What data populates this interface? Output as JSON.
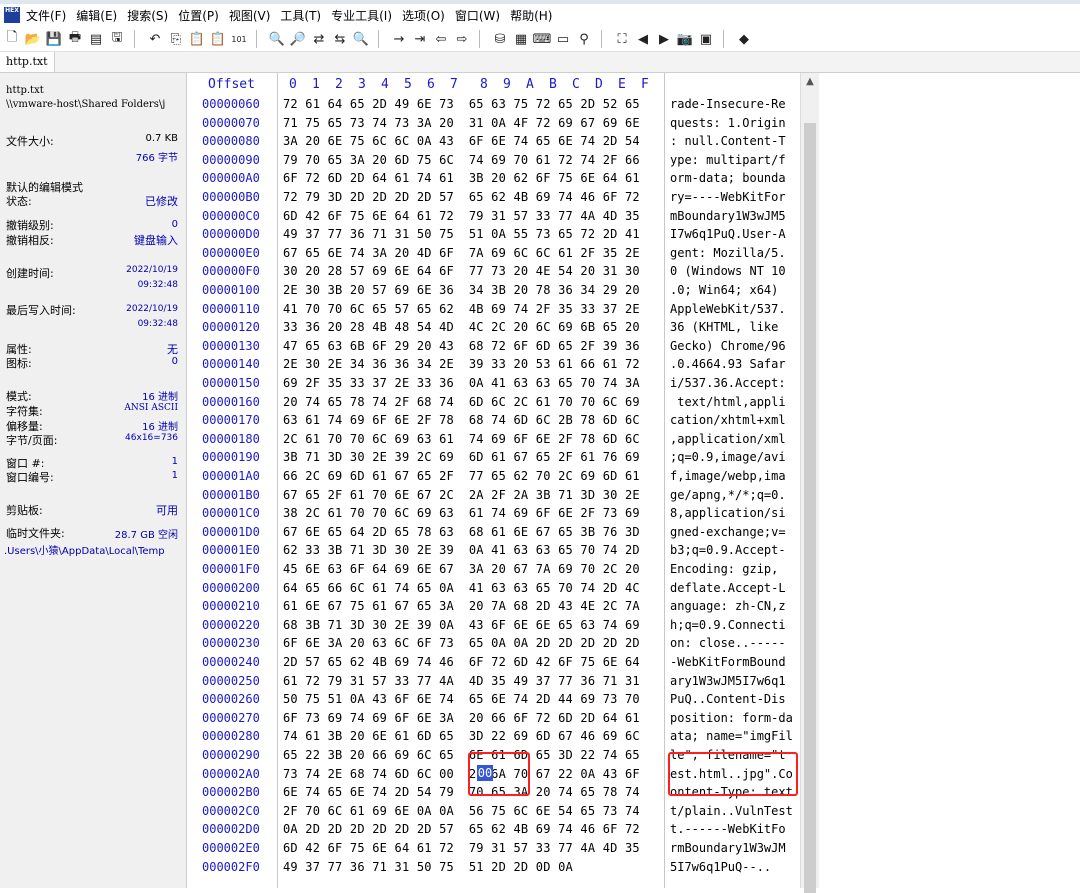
{
  "app": {
    "logo_text": "HEX"
  },
  "menu": [
    "文件(F)",
    "编辑(E)",
    "搜索(S)",
    "位置(P)",
    "视图(V)",
    "工具(T)",
    "专业工具(I)",
    "选项(O)",
    "窗口(W)",
    "帮助(H)"
  ],
  "toolbar_icons": [
    "new-file",
    "open-folder",
    "save",
    "print",
    "properties",
    "open-disk",
    "sep",
    "undo",
    "copy",
    "paste",
    "paste-special",
    "copy-hex",
    "sep",
    "find",
    "find-hex",
    "replace",
    "replace-hex",
    "find-next",
    "sep",
    "goto-offset",
    "goto-sector",
    "back",
    "forward",
    "sep",
    "disk-editor",
    "ram-editor",
    "calculator",
    "data-interpreter",
    "magnifier",
    "sep",
    "analysis",
    "previous",
    "next",
    "camera",
    "table",
    "sep",
    "bookmark"
  ],
  "tab": {
    "name": "http.txt"
  },
  "sidebar": {
    "file_name": "http.txt",
    "path": "\\\\vmware-host\\Shared Folders\\j",
    "size_label": "文件大小:",
    "size_kb": "0.7 KB",
    "size_bytes": "766 字节",
    "edit_mode_label": "默认的编辑模式",
    "state_label": "状态:",
    "state_value": "已修改",
    "undo_level_label": "撤销级别:",
    "undo_level_value": "0",
    "undo_reverse_label": "撤销相反:",
    "undo_reverse_value": "键盘输入",
    "created_label": "创建时间:",
    "created_date": "2022/10/19",
    "created_time": "09:32:48",
    "modified_label": "最后写入时间:",
    "modified_date": "2022/10/19",
    "modified_time": "09:32:48",
    "attr_label": "属性:",
    "attr_value": "无",
    "icon_label": "图标:",
    "icon_value": "0",
    "mode_label": "模式:",
    "mode_value": "16 进制",
    "charset_label": "字符集:",
    "charset_value": "ANSI ASCII",
    "offset_label": "偏移量:",
    "offset_value": "16 进制",
    "bpp_label": "字节/页面:",
    "bpp_value": "46x16=736",
    "window_label": "窗口 #:",
    "window_value": "1",
    "window_no_label": "窗口编号:",
    "window_no_value": "1",
    "clipboard_label": "剪贴板:",
    "clipboard_value": "可用",
    "tempfolder_label": "临时文件夹:",
    "tempfolder_value": "28.7 GB 空闲",
    "temp_path": ".Users\\小猿\\AppData\\Local\\Temp"
  },
  "editor": {
    "offset_header": "Offset",
    "col_headers": [
      "0",
      "1",
      "2",
      "3",
      "4",
      "5",
      "6",
      "7",
      "8",
      "9",
      "A",
      "B",
      "C",
      "D",
      "E",
      "F"
    ],
    "rows": [
      {
        "offset": "00000060",
        "hex": "72 61 64 65 2D 49 6E 73  65 63 75 72 65 2D 52 65",
        "ascii": "rade-Insecure-Re"
      },
      {
        "offset": "00000070",
        "hex": "71 75 65 73 74 73 3A 20  31 0A 4F 72 69 67 69 6E",
        "ascii": "quests: 1.Origin"
      },
      {
        "offset": "00000080",
        "hex": "3A 20 6E 75 6C 6C 0A 43  6F 6E 74 65 6E 74 2D 54",
        "ascii": ": null.Content-T"
      },
      {
        "offset": "00000090",
        "hex": "79 70 65 3A 20 6D 75 6C  74 69 70 61 72 74 2F 66",
        "ascii": "ype: multipart/f"
      },
      {
        "offset": "000000A0",
        "hex": "6F 72 6D 2D 64 61 74 61  3B 20 62 6F 75 6E 64 61",
        "ascii": "orm-data; bounda"
      },
      {
        "offset": "000000B0",
        "hex": "72 79 3D 2D 2D 2D 2D 57  65 62 4B 69 74 46 6F 72",
        "ascii": "ry=----WebKitFor"
      },
      {
        "offset": "000000C0",
        "hex": "6D 42 6F 75 6E 64 61 72  79 31 57 33 77 4A 4D 35",
        "ascii": "mBoundary1W3wJM5"
      },
      {
        "offset": "000000D0",
        "hex": "49 37 77 36 71 31 50 75  51 0A 55 73 65 72 2D 41",
        "ascii": "I7w6q1PuQ.User-A"
      },
      {
        "offset": "000000E0",
        "hex": "67 65 6E 74 3A 20 4D 6F  7A 69 6C 6C 61 2F 35 2E",
        "ascii": "gent: Mozilla/5."
      },
      {
        "offset": "000000F0",
        "hex": "30 20 28 57 69 6E 64 6F  77 73 20 4E 54 20 31 30",
        "ascii": "0 (Windows NT 10"
      },
      {
        "offset": "00000100",
        "hex": "2E 30 3B 20 57 69 6E 36  34 3B 20 78 36 34 29 20",
        "ascii": ".0; Win64; x64) "
      },
      {
        "offset": "00000110",
        "hex": "41 70 70 6C 65 57 65 62  4B 69 74 2F 35 33 37 2E",
        "ascii": "AppleWebKit/537."
      },
      {
        "offset": "00000120",
        "hex": "33 36 20 28 4B 48 54 4D  4C 2C 20 6C 69 6B 65 20",
        "ascii": "36 (KHTML, like "
      },
      {
        "offset": "00000130",
        "hex": "47 65 63 6B 6F 29 20 43  68 72 6F 6D 65 2F 39 36",
        "ascii": "Gecko) Chrome/96"
      },
      {
        "offset": "00000140",
        "hex": "2E 30 2E 34 36 36 34 2E  39 33 20 53 61 66 61 72",
        "ascii": ".0.4664.93 Safar"
      },
      {
        "offset": "00000150",
        "hex": "69 2F 35 33 37 2E 33 36  0A 41 63 63 65 70 74 3A",
        "ascii": "i/537.36.Accept:"
      },
      {
        "offset": "00000160",
        "hex": "20 74 65 78 74 2F 68 74  6D 6C 2C 61 70 70 6C 69",
        "ascii": " text/html,appli"
      },
      {
        "offset": "00000170",
        "hex": "63 61 74 69 6F 6E 2F 78  68 74 6D 6C 2B 78 6D 6C",
        "ascii": "cation/xhtml+xml"
      },
      {
        "offset": "00000180",
        "hex": "2C 61 70 70 6C 69 63 61  74 69 6F 6E 2F 78 6D 6C",
        "ascii": ",application/xml"
      },
      {
        "offset": "00000190",
        "hex": "3B 71 3D 30 2E 39 2C 69  6D 61 67 65 2F 61 76 69",
        "ascii": ";q=0.9,image/avi"
      },
      {
        "offset": "000001A0",
        "hex": "66 2C 69 6D 61 67 65 2F  77 65 62 70 2C 69 6D 61",
        "ascii": "f,image/webp,ima"
      },
      {
        "offset": "000001B0",
        "hex": "67 65 2F 61 70 6E 67 2C  2A 2F 2A 3B 71 3D 30 2E",
        "ascii": "ge/apng,*/*;q=0."
      },
      {
        "offset": "000001C0",
        "hex": "38 2C 61 70 70 6C 69 63  61 74 69 6F 6E 2F 73 69",
        "ascii": "8,application/si"
      },
      {
        "offset": "000001D0",
        "hex": "67 6E 65 64 2D 65 78 63  68 61 6E 67 65 3B 76 3D",
        "ascii": "gned-exchange;v="
      },
      {
        "offset": "000001E0",
        "hex": "62 33 3B 71 3D 30 2E 39  0A 41 63 63 65 70 74 2D",
        "ascii": "b3;q=0.9.Accept-"
      },
      {
        "offset": "000001F0",
        "hex": "45 6E 63 6F 64 69 6E 67  3A 20 67 7A 69 70 2C 20",
        "ascii": "Encoding: gzip, "
      },
      {
        "offset": "00000200",
        "hex": "64 65 66 6C 61 74 65 0A  41 63 63 65 70 74 2D 4C",
        "ascii": "deflate.Accept-L"
      },
      {
        "offset": "00000210",
        "hex": "61 6E 67 75 61 67 65 3A  20 7A 68 2D 43 4E 2C 7A",
        "ascii": "anguage: zh-CN,z"
      },
      {
        "offset": "00000220",
        "hex": "68 3B 71 3D 30 2E 39 0A  43 6F 6E 6E 65 63 74 69",
        "ascii": "h;q=0.9.Connecti"
      },
      {
        "offset": "00000230",
        "hex": "6F 6E 3A 20 63 6C 6F 73  65 0A 0A 2D 2D 2D 2D 2D",
        "ascii": "on: close..-----"
      },
      {
        "offset": "00000240",
        "hex": "2D 57 65 62 4B 69 74 46  6F 72 6D 42 6F 75 6E 64",
        "ascii": "-WebKitFormBound"
      },
      {
        "offset": "00000250",
        "hex": "61 72 79 31 57 33 77 4A  4D 35 49 37 77 36 71 31",
        "ascii": "ary1W3wJM5I7w6q1"
      },
      {
        "offset": "00000260",
        "hex": "50 75 51 0A 43 6F 6E 74  65 6E 74 2D 44 69 73 70",
        "ascii": "PuQ..Content-Dis"
      },
      {
        "offset": "00000270",
        "hex": "6F 73 69 74 69 6F 6E 3A  20 66 6F 72 6D 2D 64 61",
        "ascii": "position: form-da"
      },
      {
        "offset": "00000280",
        "hex": "74 61 3B 20 6E 61 6D 65  3D 22 69 6D 67 46 69 6C",
        "ascii": "ata; name=\"imgFil"
      },
      {
        "offset": "00000290",
        "hex": "65 22 3B 20 66 69 6C 65  6E 61 6D 65 3D 22 74 65",
        "ascii": "le\"; filename=\"t"
      },
      {
        "offset": "000002A0",
        "hex": "73 74 2E 68 74 6D 6C 00  2E 6A 70 67 22 0A 43 6F",
        "ascii": "est.html..jpg\".Co"
      },
      {
        "offset": "000002B0",
        "hex": "6E 74 65 6E 74 2D 54 79  70 65 3A 20 74 65 78 74",
        "ascii": "ontent-Type: text"
      },
      {
        "offset": "000002C0",
        "hex": "2F 70 6C 61 69 6E 0A 0A  56 75 6C 6E 54 65 73 74",
        "ascii": "t/plain..VulnTest"
      },
      {
        "offset": "000002D0",
        "hex": "0A 2D 2D 2D 2D 2D 2D 57  65 62 4B 69 74 46 6F 72",
        "ascii": "t.------WebKitFo"
      },
      {
        "offset": "000002E0",
        "hex": "6D 42 6F 75 6E 64 61 72  79 31 57 33 77 4A 4D 35",
        "ascii": "rmBoundary1W3wJM"
      },
      {
        "offset": "000002F0",
        "hex": "49 37 77 36 71 31 50 75  51 2D 2D 0D 0A",
        "ascii": "5I7w6q1PuQ--.."
      }
    ],
    "selected_byte": "00"
  }
}
